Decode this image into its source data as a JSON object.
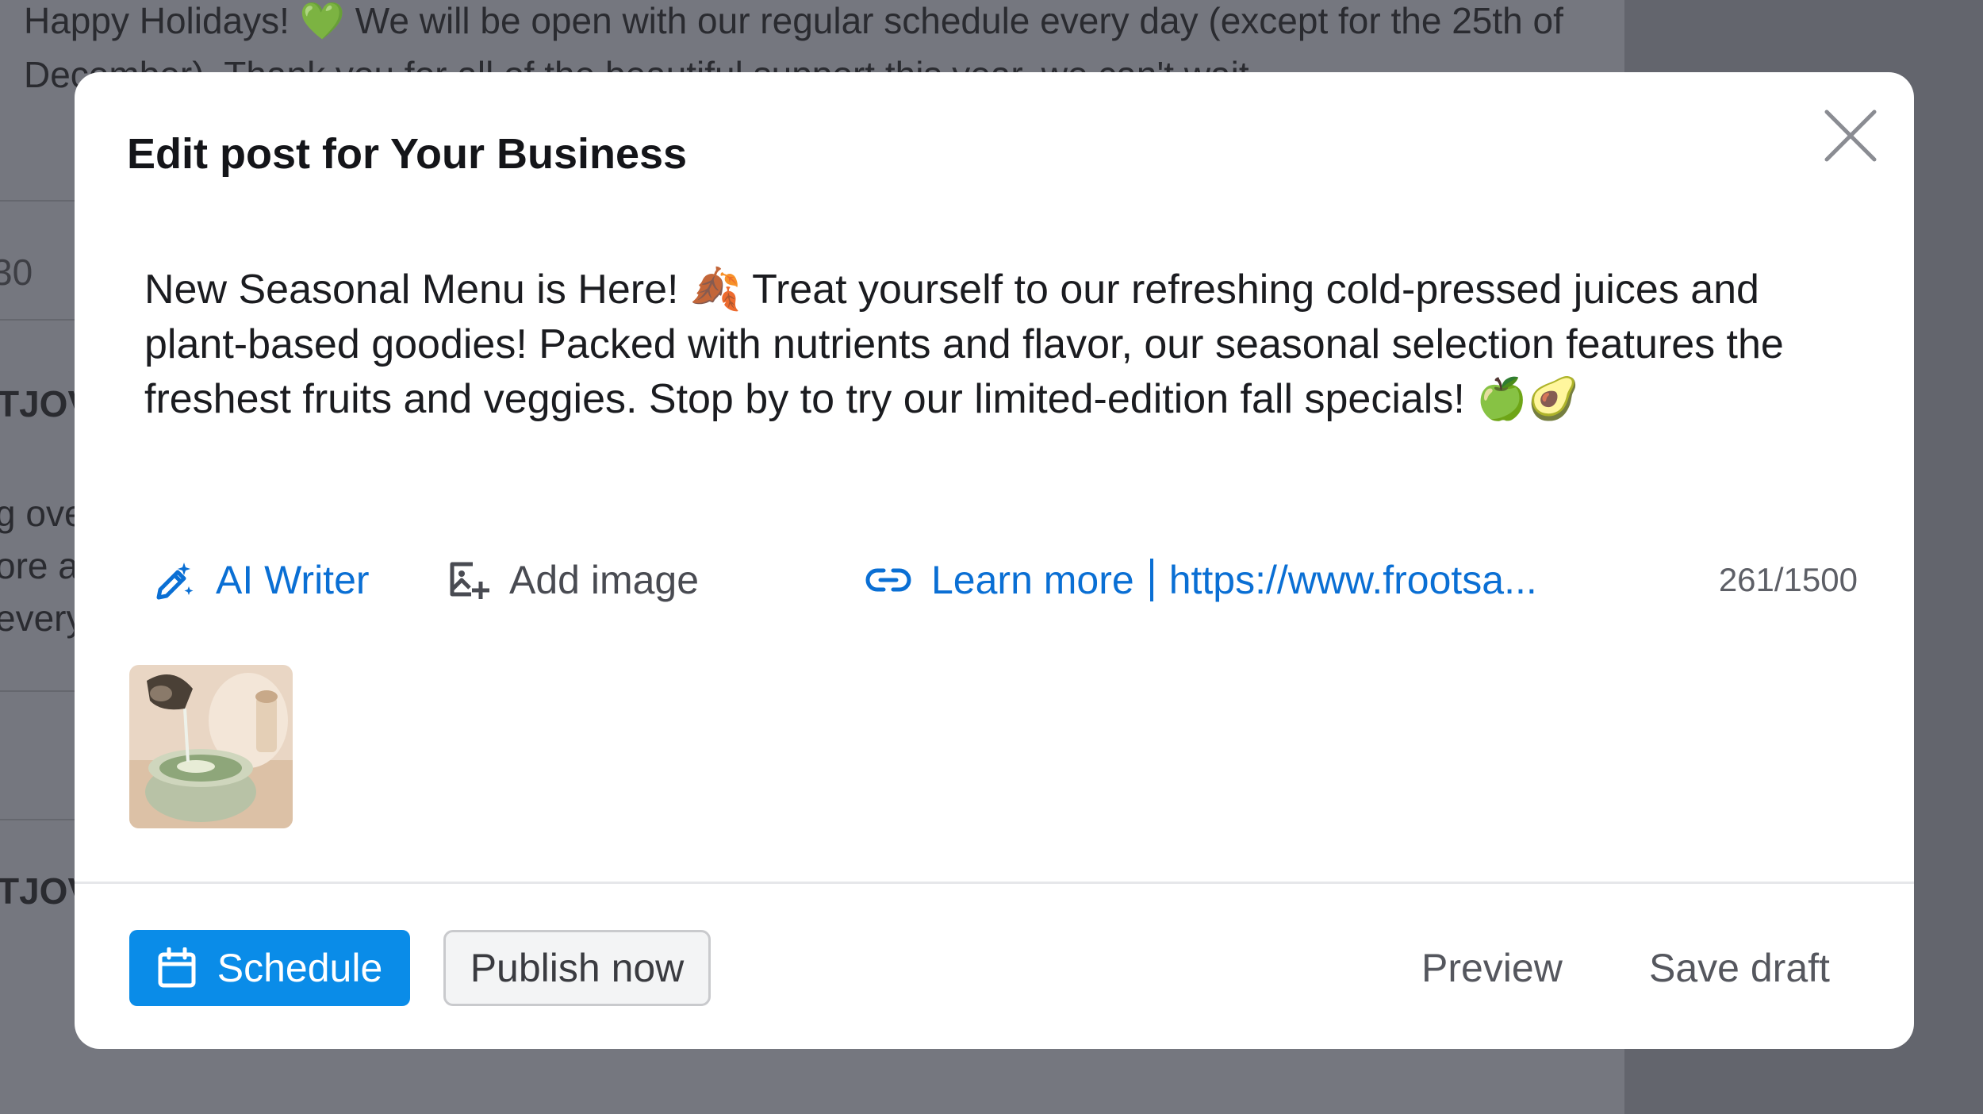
{
  "background": {
    "announcement": "Happy Holidays! 💚 We will be open with our regular schedule every day (except for the 25th of December). Thank you for all of the beautiful support this year, we can't wait",
    "fragments": [
      "30",
      "TJOV",
      "g ove",
      "ore a",
      "every",
      "TJOV"
    ]
  },
  "modal": {
    "title": "Edit post for Your Business",
    "post_text": "New Seasonal Menu is Here! 🍂 Treat yourself to our refreshing cold-pressed juices and plant-based goodies! Packed with nutrients and flavor, our seasonal selection features the freshest fruits and veggies. Stop by to try our limited-edition fall specials! 🍏🥑",
    "toolbar": {
      "ai_writer": "AI Writer",
      "add_image": "Add image",
      "cta_label": "Learn more",
      "cta_url": "https://www.frootsa...",
      "counter": "261/1500"
    },
    "footer": {
      "schedule": "Schedule",
      "publish_now": "Publish now",
      "preview": "Preview",
      "save_draft": "Save draft"
    }
  },
  "colors": {
    "accent_blue": "#0a8ce8",
    "link_blue": "#0a6fd4",
    "overlay": "#75777f"
  },
  "icons": [
    "close-icon",
    "ai-writer-icon",
    "add-image-icon",
    "link-icon",
    "calendar-icon"
  ]
}
